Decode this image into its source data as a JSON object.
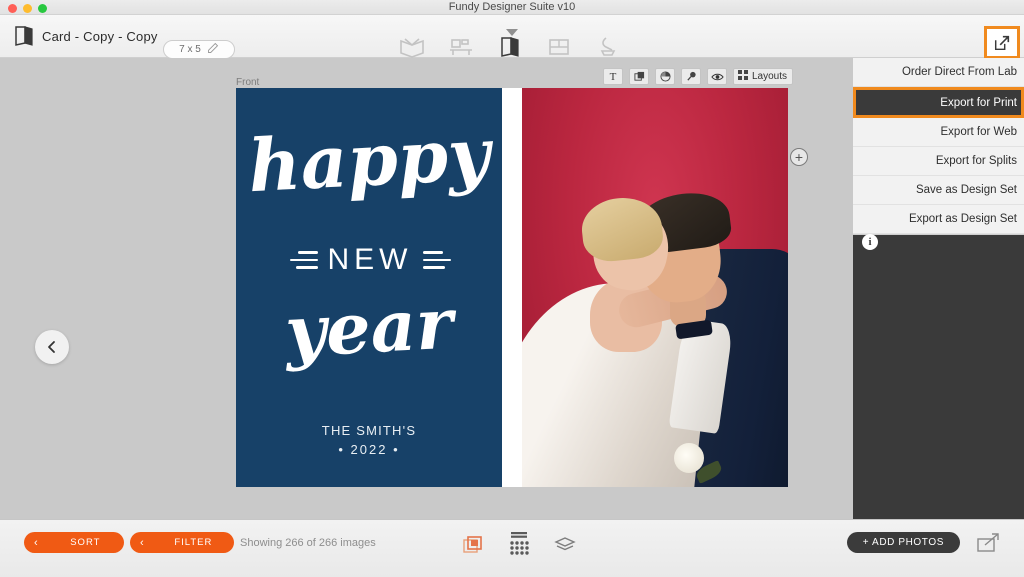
{
  "window": {
    "app_title": "Fundy Designer Suite v10",
    "traffic_lights": [
      "close",
      "minimize",
      "zoom"
    ]
  },
  "toolbar": {
    "document_icon": "card-document-icon",
    "document_name": "Card - Copy - Copy",
    "size_chip": {
      "value": "7 x 5",
      "edit_icon": "pencil-icon"
    },
    "nav_items": [
      {
        "name": "album-icon",
        "active": false
      },
      {
        "name": "wall-art-icon",
        "active": false
      },
      {
        "name": "card-icon",
        "active": true
      },
      {
        "name": "layout-grid-icon",
        "active": false
      },
      {
        "name": "press-printing-icon",
        "active": false
      }
    ],
    "export_button_icon": "export-share-icon"
  },
  "canvas": {
    "side_label": "Front",
    "card_tools": [
      {
        "name": "text-tool",
        "glyph": "T"
      },
      {
        "name": "layers-tool",
        "glyph": "layers"
      },
      {
        "name": "color-tool",
        "glyph": "color-wheel"
      },
      {
        "name": "pin-tool",
        "glyph": "pin"
      },
      {
        "name": "preview-eye-tool",
        "glyph": "eye"
      }
    ],
    "layouts_button": {
      "label": "Layouts",
      "icon": "grid-icon"
    },
    "add_page_icon": "plus-circle-icon",
    "prev_spread_icon": "chevron-left-icon",
    "card": {
      "background_color": "#174168",
      "line1": "happy",
      "line2": "NEW",
      "line3": "year",
      "signature_name": "THE SMITH'S",
      "signature_year": "• 2022 •"
    },
    "photo": {
      "description": "wedding-couple-photo",
      "background_color": "#b8253e"
    }
  },
  "menu": {
    "items": [
      {
        "label": "Order Direct From Lab",
        "selected": false
      },
      {
        "label": "Export for Print",
        "selected": true
      },
      {
        "label": "Export for Web",
        "selected": false
      },
      {
        "label": "Export for Splits",
        "selected": false
      },
      {
        "label": "Save as Design Set",
        "selected": false
      },
      {
        "label": "Export as Design Set",
        "selected": false
      }
    ],
    "info_icon": "info-icon",
    "highlight_color": "#f08a1e",
    "selected_background": "#3a3a3a"
  },
  "bottom_bar": {
    "sort_button": {
      "label": "SORT",
      "chevron": "chevron-left-icon"
    },
    "filter_button": {
      "label": "FILTER",
      "chevron": "chevron-left-icon"
    },
    "status_text": "Showing 266 of 266 images",
    "center_icons": [
      {
        "name": "photo-stack-icon",
        "active": true
      },
      {
        "name": "dot-grid-icon",
        "active": false
      },
      {
        "name": "layers-stack-icon",
        "active": false
      }
    ],
    "add_photos_button": "+ ADD PHOTOS",
    "expand_icon": "expand-export-icon",
    "accent_color": "#f05a14"
  }
}
